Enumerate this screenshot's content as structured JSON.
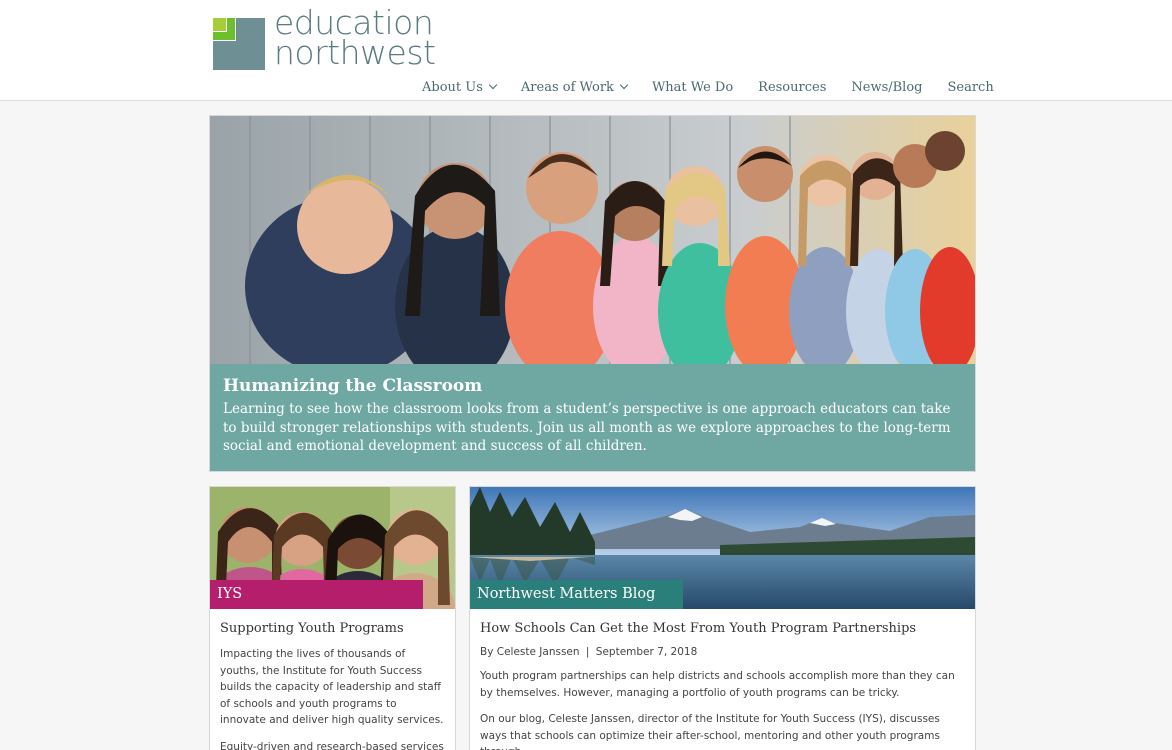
{
  "brand": {
    "name_line1": "education",
    "name_line2": "northwest",
    "colors": {
      "green": "#6cbf2d",
      "lime": "#a6ce39",
      "slate": "#6e8f94"
    }
  },
  "nav": {
    "items": [
      {
        "label": "About Us",
        "has_dropdown": true
      },
      {
        "label": "Areas of Work",
        "has_dropdown": true
      },
      {
        "label": "What We Do",
        "has_dropdown": false
      },
      {
        "label": "Resources",
        "has_dropdown": false
      },
      {
        "label": "News/Blog",
        "has_dropdown": false
      },
      {
        "label": "Search",
        "has_dropdown": false
      }
    ]
  },
  "hero": {
    "title": "Humanizing the Classroom",
    "text": "Learning to see how the classroom looks from a student’s perspective is one approach educators can take to build stronger relationships with students. Join us all month as we explore approaches to the long-term social and emotional development and success of all children.",
    "caption_color": "#6fa7a3"
  },
  "cards": {
    "iys": {
      "label": "IYS",
      "title": "Supporting Youth Programs",
      "p1": "Impacting the lives of thousands of youths, the Institute for Youth Success builds the capacity of leadership and staff of schools and youth programs to innovate and deliver high quality services.",
      "p2": "Equity-driven and research-based services",
      "label_color": "#b51e6a"
    },
    "blog": {
      "label": "Northwest Matters Blog",
      "title": "How Schools Can Get the Most From Youth Program Partnerships",
      "author": "By Celeste Janssen",
      "separator": "|",
      "date": "September 7, 2018",
      "p1": "Youth program partnerships can help districts and schools accomplish more than they can by themselves. However, managing a portfolio of youth programs can be tricky.",
      "p2": "On our blog, Celeste Janssen, director of the Institute for Youth Success (IYS), discusses ways that schools can optimize their after-school, mentoring and other youth programs through",
      "label_color": "#2b7f7a"
    }
  }
}
